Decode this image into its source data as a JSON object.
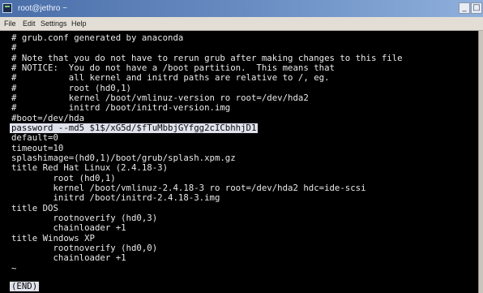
{
  "window": {
    "title": "root@jethro ~",
    "buttons": {
      "minimize": "_",
      "maximize": "□"
    }
  },
  "menu": {
    "items": [
      "File",
      "Edit",
      "Settings",
      "Help"
    ]
  },
  "terminal": {
    "lines": [
      "# grub.conf generated by anaconda",
      "#",
      "# Note that you do not have to rerun grub after making changes to this file",
      "# NOTICE:  You do not have a /boot partition.  This means that",
      "#          all kernel and initrd paths are relative to /, eg.",
      "#          root (hd0,1)",
      "#          kernel /boot/vmlinuz-version ro root=/dev/hda2",
      "#          initrd /boot/initrd-version.img",
      "#boot=/dev/hda",
      "password --md5 $1$/xG5d/$fTuMbbjGYfgg2cICbhhjD1",
      "default=0",
      "timeout=10",
      "splashimage=(hd0,1)/boot/grub/splash.xpm.gz",
      "title Red Hat Linux (2.4.18-3)",
      "        root (hd0,1)",
      "        kernel /boot/vmlinuz-2.4.18-3 ro root=/dev/hda2 hdc=ide-scsi",
      "        initrd /boot/initrd-2.4.18-3.img",
      "title DOS",
      "        rootnoverify (hd0,3)",
      "        chainloader +1",
      "title Windows XP",
      "        rootnoverify (hd0,0)",
      "        chainloader +1",
      "~"
    ],
    "status": "(END)"
  }
}
